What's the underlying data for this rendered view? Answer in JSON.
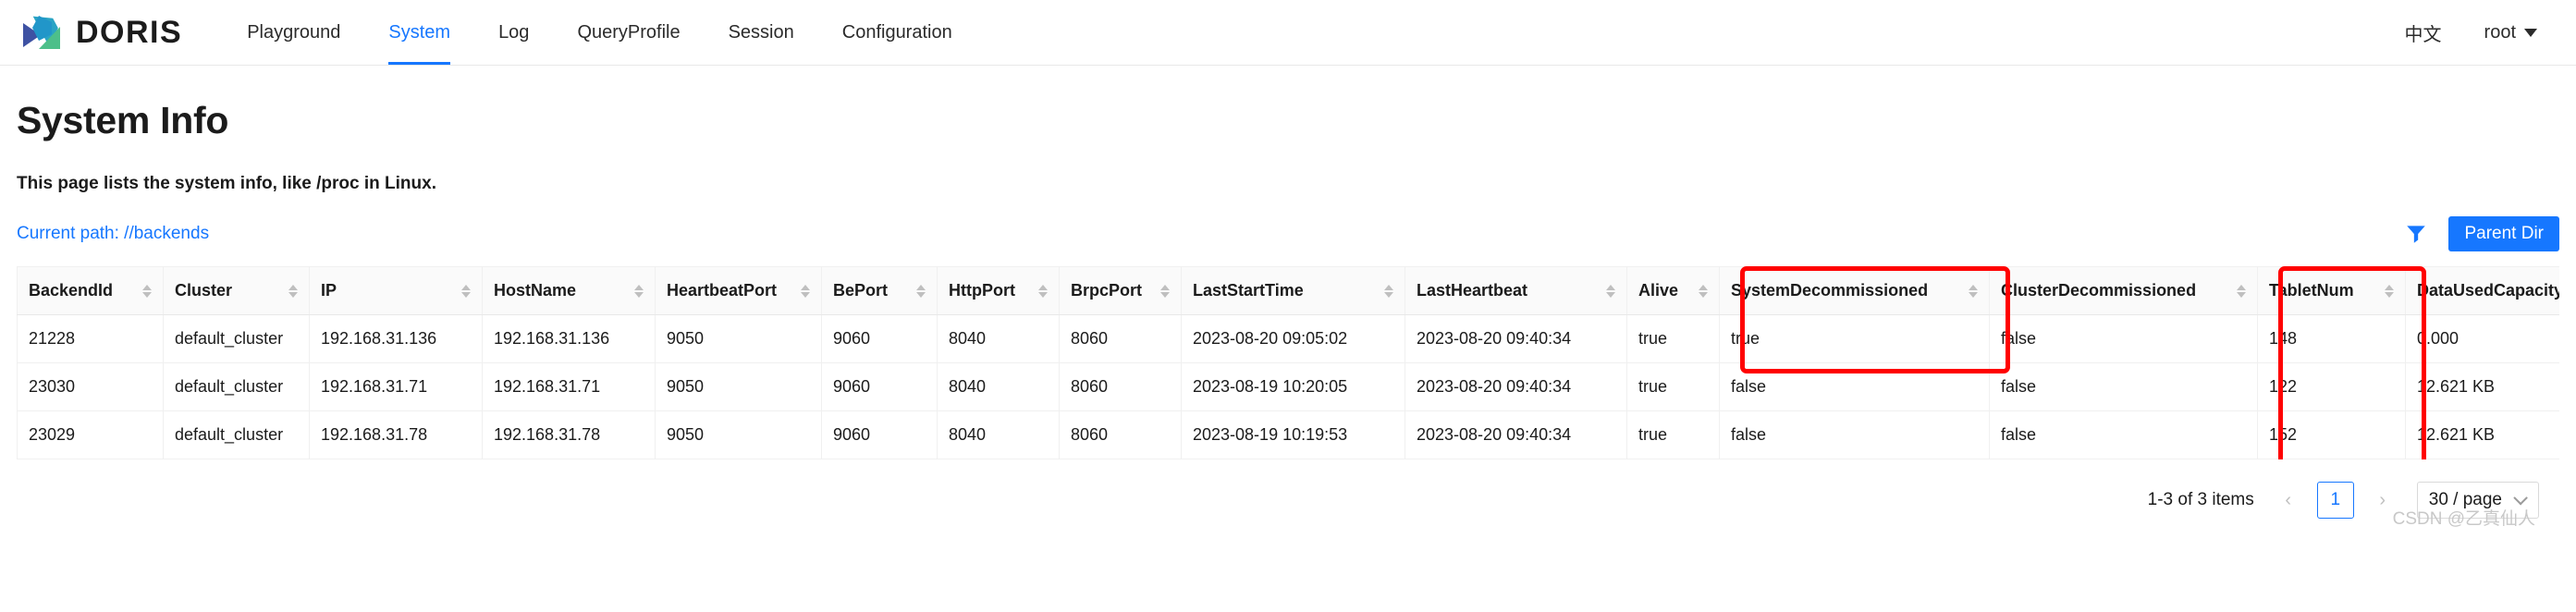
{
  "header": {
    "brand": "DORIS",
    "logo_icon": "doris-logo-icon",
    "nav": [
      {
        "label": "Playground",
        "active": false
      },
      {
        "label": "System",
        "active": true
      },
      {
        "label": "Log",
        "active": false
      },
      {
        "label": "QueryProfile",
        "active": false
      },
      {
        "label": "Session",
        "active": false
      },
      {
        "label": "Configuration",
        "active": false
      }
    ],
    "lang_label": "中文",
    "user_label": "root"
  },
  "page": {
    "title": "System Info",
    "description": "This page lists the system info, like /proc in Linux.",
    "current_path": "Current path: //backends",
    "filter_icon": "filter-funnel-icon",
    "parent_dir_label": "Parent Dir"
  },
  "table": {
    "columns": [
      "BackendId",
      "Cluster",
      "IP",
      "HostName",
      "HeartbeatPort",
      "BePort",
      "HttpPort",
      "BrpcPort",
      "LastStartTime",
      "LastHeartbeat",
      "Alive",
      "SystemDecommissioned",
      "ClusterDecommissioned",
      "TabletNum",
      "DataUsedCapacity"
    ],
    "rows": [
      {
        "BackendId": "21228",
        "Cluster": "default_cluster",
        "IP": "192.168.31.136",
        "HostName": "192.168.31.136",
        "HeartbeatPort": "9050",
        "BePort": "9060",
        "HttpPort": "8040",
        "BrpcPort": "8060",
        "LastStartTime": "2023-08-20 09:05:02",
        "LastHeartbeat": "2023-08-20 09:40:34",
        "Alive": "true",
        "SystemDecommissioned": "true",
        "ClusterDecommissioned": "false",
        "TabletNum": "148",
        "DataUsedCapacity": "0.000"
      },
      {
        "BackendId": "23030",
        "Cluster": "default_cluster",
        "IP": "192.168.31.71",
        "HostName": "192.168.31.71",
        "HeartbeatPort": "9050",
        "BePort": "9060",
        "HttpPort": "8040",
        "BrpcPort": "8060",
        "LastStartTime": "2023-08-19 10:20:05",
        "LastHeartbeat": "2023-08-20 09:40:34",
        "Alive": "true",
        "SystemDecommissioned": "false",
        "ClusterDecommissioned": "false",
        "TabletNum": "122",
        "DataUsedCapacity": "12.621 KB"
      },
      {
        "BackendId": "23029",
        "Cluster": "default_cluster",
        "IP": "192.168.31.78",
        "HostName": "192.168.31.78",
        "HeartbeatPort": "9050",
        "BePort": "9060",
        "HttpPort": "8040",
        "BrpcPort": "8060",
        "LastStartTime": "2023-08-19 10:19:53",
        "LastHeartbeat": "2023-08-20 09:40:34",
        "Alive": "true",
        "SystemDecommissioned": "false",
        "ClusterDecommissioned": "false",
        "TabletNum": "152",
        "DataUsedCapacity": "12.621 KB"
      }
    ]
  },
  "annotations": [
    {
      "name": "system-decommissioned-highlight",
      "color": "#ff0000"
    },
    {
      "name": "tablet-num-highlight",
      "color": "#ff0000"
    }
  ],
  "pagination": {
    "total_label": "1-3 of 3 items",
    "prev_icon": "chevron-left-icon",
    "next_icon": "chevron-right-icon",
    "current_page": "1",
    "page_size_label": "30 / page"
  },
  "watermark": "CSDN @乙真仙人",
  "colors": {
    "accent": "#1677ff",
    "annotation": "#ff0000",
    "header_bg": "#fafafa",
    "border": "#f0f0f0"
  }
}
